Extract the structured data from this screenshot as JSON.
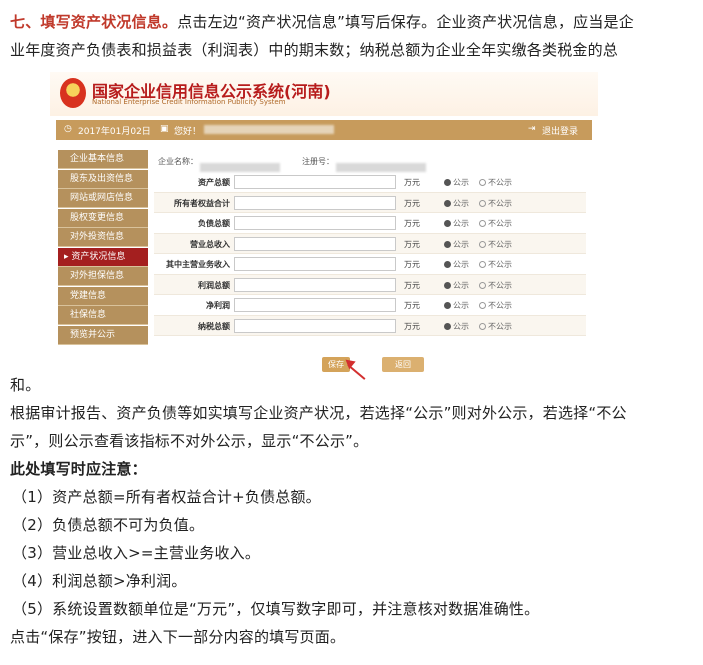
{
  "section": {
    "heading": "七、填写资产状况信息。",
    "intro_line1": "点击左边“资产状况信息”填写后保存。企业资产状况信息，应当是企",
    "intro_line2": "业年度资产负债表和损益表（利润表）中的期末数；纳税总额为企业全年实缴各类税金的总",
    "intro_line3": "和。"
  },
  "screenshot": {
    "system_title_cn": "国家企业信用信息公示系统(河南)",
    "system_title_en": "National Enterprise Credit Information Publicity System",
    "topbar": {
      "date": "2017年01月02日",
      "greeting": "您好！",
      "logout": "退出登录"
    },
    "sidebar": [
      {
        "label": "企业基本信息"
      },
      {
        "label": "股东及出资信息"
      },
      {
        "label": "网站或网店信息"
      },
      {
        "label": "股权变更信息"
      },
      {
        "label": "对外投资信息"
      },
      {
        "label": "资产状况信息"
      },
      {
        "label": "对外担保信息"
      },
      {
        "label": "党建信息"
      },
      {
        "label": "社保信息"
      },
      {
        "label": "预览并公示"
      }
    ],
    "meta": {
      "company_name_label": "企业名称：",
      "reg_no_label": "注册号："
    },
    "unit": "万元",
    "public_label": "公示",
    "not_public_label": "不公示",
    "fields": [
      {
        "label": "资产总额"
      },
      {
        "label": "所有者权益合计"
      },
      {
        "label": "负债总额"
      },
      {
        "label": "营业总收入"
      },
      {
        "label": "其中主营业务收入"
      },
      {
        "label": "利润总额"
      },
      {
        "label": "净利润"
      },
      {
        "label": "纳税总额"
      }
    ],
    "save_button": "保存",
    "back_button": "返回"
  },
  "body": {
    "para1_line1": "根据审计报告、资产负债等如实填写企业资产状况，若选择“公示”则对外公示，若选择“不公",
    "para1_line2": "示”，则公示查看该指标不对外公示，显示“不公示”。",
    "notice_heading": "此处填写时应注意：",
    "rules": [
      "（1）资产总额=所有者权益合计+负债总额。",
      "（2）负债总额不可为负值。",
      "（3）营业总收入>=主营业务收入。",
      "（4）利润总额>净利润。",
      "（5）系统设置数额单位是“万元”，仅填写数字即可，并注意核对数据准确性。"
    ],
    "closing": "点击“保存”按钮，进入下一部分内容的填写页面。"
  }
}
